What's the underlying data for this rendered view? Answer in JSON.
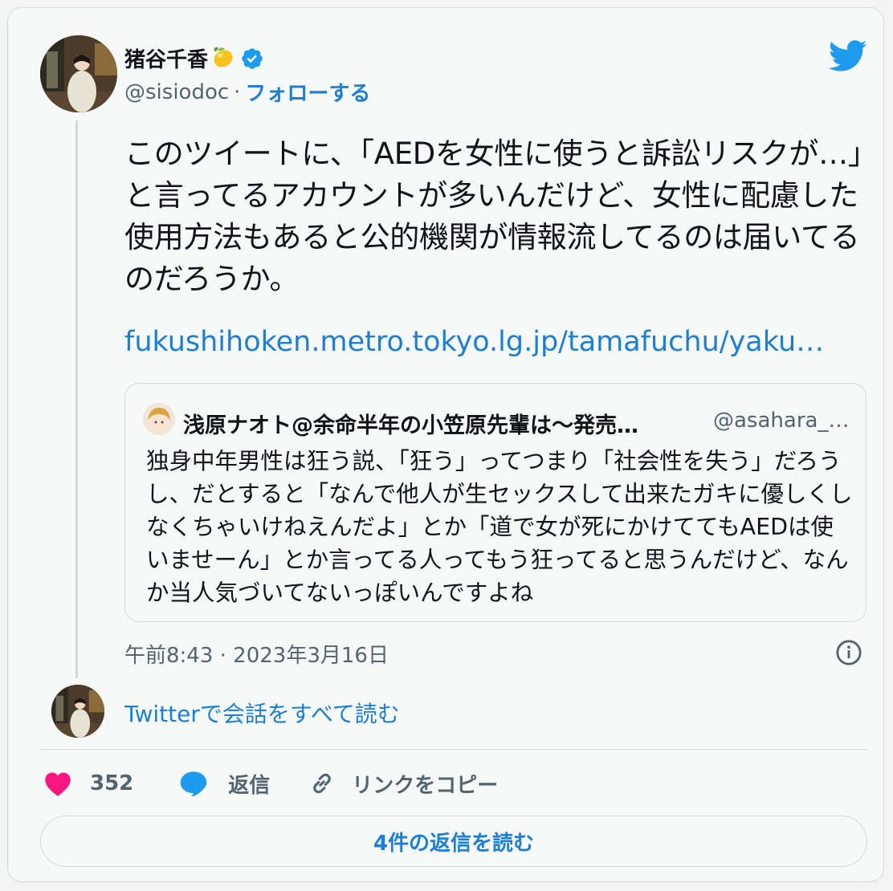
{
  "author": {
    "display_name": "猪谷千香",
    "emoji_icon": "lemon-emoji",
    "handle": "@sisiodoc",
    "separator": "·",
    "follow_label": "フォローする"
  },
  "tweet": {
    "text": "このツイートに、「AEDを女性に使うと訴訟リスクが…」と言ってるアカウントが多いんだけど、女性に配慮した使用方法もあると公的機関が情報流してるのは届いてるのだろうか。",
    "link": "fukushihoken.metro.tokyo.lg.jp/tamafuchu/yaku…",
    "timestamp": "午前8:43 · 2023年3月16日"
  },
  "quoted": {
    "name": "浅原ナオト@余命半年の小笠原先輩は～発売…",
    "handle": "@asahara_…",
    "text": "独身中年男性は狂う説、「狂う」ってつまり「社会性を失う」だろうし、だとすると「なんで他人が生セックスして出来たガキに優しくしなくちゃいけねえんだよ」とか「道で女が死にかけててもAEDは使いませーん」とか言ってる人ってもう狂ってると思うんだけど、なんか当人気づいてないっぽいんですよね"
  },
  "conversation": {
    "read_all_label": "Twitterで会話をすべて読む"
  },
  "actions": {
    "like_count": "352",
    "reply_label": "返信",
    "copy_label": "リンクをコピー"
  },
  "footer": {
    "read_replies_label": "4件の返信を読む"
  },
  "colors": {
    "accent": "#1d9bf0",
    "link": "#1d7fd4",
    "like": "#f91880",
    "muted": "#536471"
  }
}
